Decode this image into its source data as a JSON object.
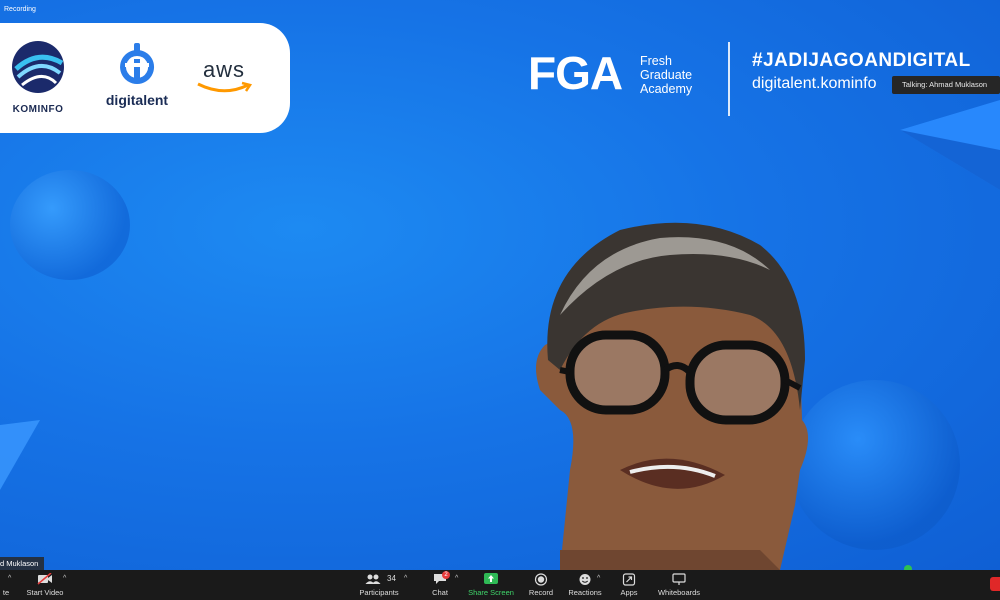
{
  "recording_label": "Recording",
  "logos": {
    "kominfo": "KOMINFO",
    "digitalent": "digitalent",
    "aws": "aws"
  },
  "banner": {
    "fga": "FGA",
    "fga_sub": [
      "Fresh",
      "Graduate",
      "Academy"
    ],
    "hashtag": "#JADIJAGOANDIGITAL",
    "site": "digitalent.kominfo"
  },
  "talking_tooltip": "Talking: Ahmad Muklason",
  "name_tag": "d Muklason",
  "toolbar": {
    "mute_label": "te",
    "start_video_label": "Start Video",
    "participants_label": "Participants",
    "participants_count": "34",
    "chat_label": "Chat",
    "chat_badge": "2",
    "share_label": "Share Screen",
    "record_label": "Record",
    "reactions_label": "Reactions",
    "apps_label": "Apps",
    "whiteboards_label": "Whiteboards"
  },
  "colors": {
    "background_blue": "#1673e6",
    "toolbar_bg": "#1a1a1a",
    "share_green": "#3fd56a",
    "badge_red": "#e53b3b"
  }
}
